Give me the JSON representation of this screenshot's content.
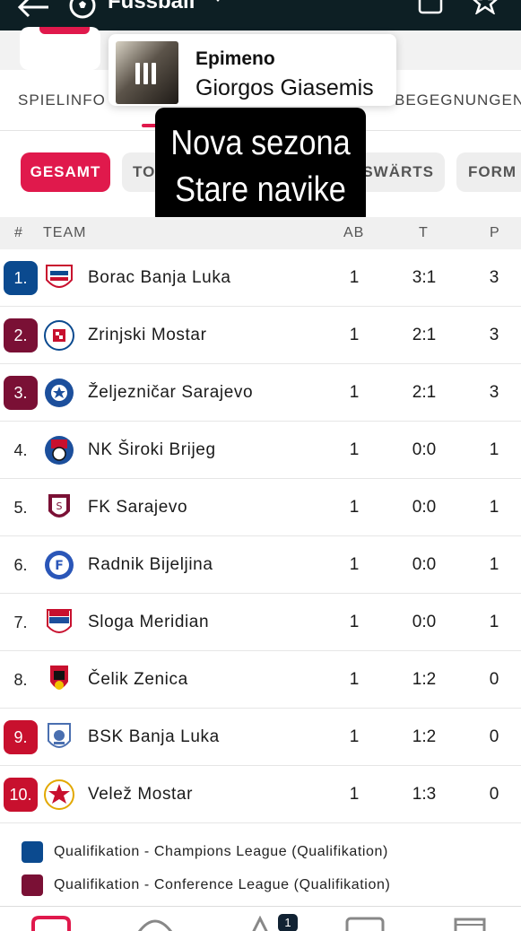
{
  "app": {
    "title": "Fussball"
  },
  "tabs": [
    {
      "label": "SPIELINFO"
    },
    {
      "label": "BEGEGNUNGEN"
    }
  ],
  "music": {
    "song": "Epimeno",
    "artist": "Giorgos Giasemis"
  },
  "caption": {
    "line1": "Nova sezona",
    "line2": "Stare navike"
  },
  "filters": [
    {
      "label": "GESAMT",
      "active": true
    },
    {
      "label": "TO"
    },
    {
      "label": "SWÄRTS"
    },
    {
      "label": "FORM"
    }
  ],
  "table": {
    "headers": {
      "rank": "#",
      "team": "TEAM",
      "ab": "AB",
      "t": "T",
      "p": "P"
    },
    "rows": [
      {
        "rank": "1.",
        "team": "Borac Banja Luka",
        "ab": "1",
        "t": "3:1",
        "p": "3",
        "zone": "cl"
      },
      {
        "rank": "2.",
        "team": "Zrinjski Mostar",
        "ab": "1",
        "t": "2:1",
        "p": "3",
        "zone": "conf"
      },
      {
        "rank": "3.",
        "team": "Željezničar Sarajevo",
        "ab": "1",
        "t": "2:1",
        "p": "3",
        "zone": "conf"
      },
      {
        "rank": "4.",
        "team": "NK Široki Brijeg",
        "ab": "1",
        "t": "0:0",
        "p": "1",
        "zone": "none"
      },
      {
        "rank": "5.",
        "team": "FK Sarajevo",
        "ab": "1",
        "t": "0:0",
        "p": "1",
        "zone": "none"
      },
      {
        "rank": "6.",
        "team": "Radnik Bijeljina",
        "ab": "1",
        "t": "0:0",
        "p": "1",
        "zone": "none"
      },
      {
        "rank": "7.",
        "team": "Sloga Meridian",
        "ab": "1",
        "t": "0:0",
        "p": "1",
        "zone": "none"
      },
      {
        "rank": "8.",
        "team": "Čelik Zenica",
        "ab": "1",
        "t": "1:2",
        "p": "0",
        "zone": "none"
      },
      {
        "rank": "9.",
        "team": "BSK Banja Luka",
        "ab": "1",
        "t": "1:2",
        "p": "0",
        "zone": "rel"
      },
      {
        "rank": "10.",
        "team": "Velež Mostar",
        "ab": "1",
        "t": "1:3",
        "p": "0",
        "zone": "rel"
      }
    ]
  },
  "legend": [
    {
      "label": "Qualifikation - Champions League (Qualifikation)",
      "color": "#0b4a8f"
    },
    {
      "label": "Qualifikation - Conference League (Qualifikation)",
      "color": "#7a1035"
    }
  ],
  "colors": {
    "accent": "#e0194c",
    "cl": "#0b4a8f",
    "conf": "#7a1035",
    "rel": "#c8102e"
  },
  "bottom_nav": {
    "badge": "1"
  }
}
